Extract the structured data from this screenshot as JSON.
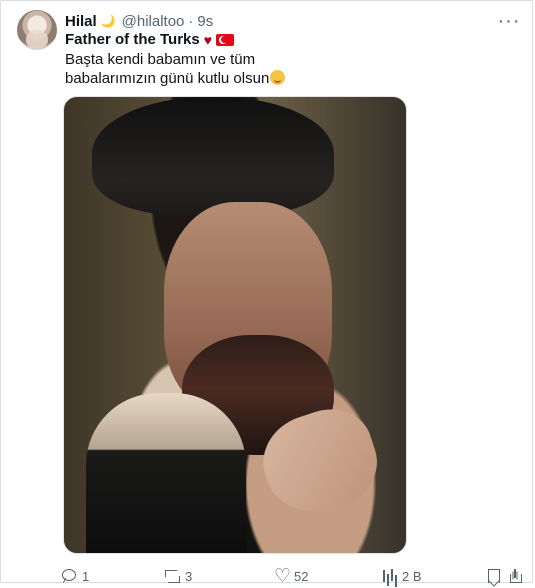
{
  "tweet": {
    "author_name": "Hilal",
    "author_emoji": "🌙",
    "handle": "@hilaltoo",
    "separator": "·",
    "time": "9s",
    "more_label": "···",
    "title": "Father of the Turks",
    "heart": "♥",
    "text_line1": "Başta kendi babamın ve tüm",
    "text_line2": "babalarımızın günü kutlu olsun",
    "image_description": "vintage portrait of a bearded man in a dark fur hat touching his mustache",
    "actions": {
      "reply_count": "1",
      "retweet_count": "3",
      "like_count": "52",
      "views_count": "2 B"
    }
  },
  "colors": {
    "muted": "#536471",
    "text": "#0f1419",
    "border": "#d7dde2"
  },
  "icons": {
    "reply": "reply-icon",
    "retweet": "retweet-icon",
    "like": "heart-icon",
    "views": "views-icon",
    "bookmark": "bookmark-icon",
    "share": "share-icon"
  }
}
